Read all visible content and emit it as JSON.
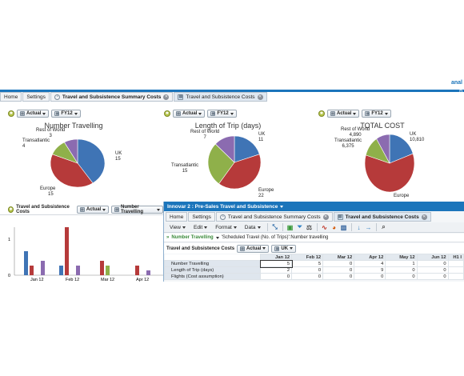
{
  "app": {
    "brand": "anal",
    "brand_sub": "p"
  },
  "tabs": [
    {
      "label": "Home"
    },
    {
      "label": "Settings"
    },
    {
      "label": "Travel and Subsistence Summary Costs"
    },
    {
      "label": "Travel and Subsistence Costs"
    }
  ],
  "pie_controls": {
    "version": "Actual",
    "period": "FY12"
  },
  "pie_charts": [
    {
      "title": "Number Travelling",
      "slices": [
        {
          "label": "UK",
          "value": 15,
          "color": "#3f74b5"
        },
        {
          "label": "Europe",
          "value": 15,
          "color": "#b63a3a"
        },
        {
          "label": "Transatlantic",
          "value": 4,
          "color": "#8fb04a"
        },
        {
          "label": "Rest of World",
          "value": 3,
          "color": "#8b6bb0"
        }
      ]
    },
    {
      "title": "Length of Trip (days)",
      "slices": [
        {
          "label": "UK",
          "value": 11,
          "color": "#3f74b5"
        },
        {
          "label": "Europe",
          "value": 22,
          "color": "#b63a3a"
        },
        {
          "label": "Transatlantic",
          "value": 15,
          "color": "#8fb04a"
        },
        {
          "label": "Rest of World",
          "value": 7,
          "color": "#8b6bb0"
        }
      ]
    },
    {
      "title": "TOTAL COST",
      "slices": [
        {
          "label": "UK",
          "value": 10810,
          "display": "10,810",
          "color": "#3f74b5"
        },
        {
          "label": "Europe",
          "value": 33000,
          "display": "",
          "color": "#b63a3a"
        },
        {
          "label": "Transatlantic",
          "value": 6375,
          "display": "6,375",
          "color": "#8fb04a"
        },
        {
          "label": "Rest of World",
          "value": 4890,
          "display": "4,890",
          "color": "#8b6bb0"
        }
      ]
    }
  ],
  "bar_section": {
    "title": "Travel and Subsistence Costs",
    "version": "Actual",
    "measure": "Number Travelling"
  },
  "chart_data": {
    "type": "bar",
    "categories": [
      "Jan 12",
      "Feb 12",
      "Mar 12",
      "Apr 12"
    ],
    "series": [
      {
        "values": [
          5,
          2,
          0,
          0
        ],
        "color": "#3f74b5"
      },
      {
        "values": [
          2,
          10,
          3,
          2
        ],
        "color": "#b63a3a"
      },
      {
        "values": [
          0,
          0,
          2,
          0
        ],
        "color": "#8fb04a"
      },
      {
        "values": [
          3,
          2,
          0,
          1
        ],
        "color": "#8b6bb0"
      }
    ],
    "yticks": [
      "1",
      "0"
    ],
    "ylim": [
      0,
      10
    ]
  },
  "inner": {
    "header": "Innovar 2 : Pre-Sales Travel and Subsistence",
    "tabs": [
      {
        "label": "Home"
      },
      {
        "label": "Settings"
      },
      {
        "label": "Travel and Subsistence Summary Costs"
      },
      {
        "label": "Travel and Subsistence Costs"
      }
    ],
    "menus": [
      "View",
      "Edit",
      "Format",
      "Data"
    ],
    "filter": {
      "measure": "Number Travelling",
      "path": "'Scheduled Travel (No. of Trips)':Number travelling"
    },
    "grid_title": "Travel and Subsistence Costs",
    "version": "Actual",
    "region": "UK",
    "columns": [
      "Jan 12",
      "Feb 12",
      "Mar 12",
      "Apr 12",
      "May 12",
      "Jun 12",
      "H1 I"
    ],
    "rows": [
      {
        "label": "Number Travelling",
        "values": [
          "5",
          "5",
          "0",
          "4",
          "1",
          "0",
          ""
        ]
      },
      {
        "label": "Length of Trip (days)",
        "values": [
          "2",
          "0",
          "0",
          "9",
          "0",
          "0",
          ""
        ]
      },
      {
        "label": "Flights (Cost assumption)",
        "values": [
          "0",
          "0",
          "0",
          "0",
          "0",
          "0",
          ""
        ]
      }
    ]
  }
}
